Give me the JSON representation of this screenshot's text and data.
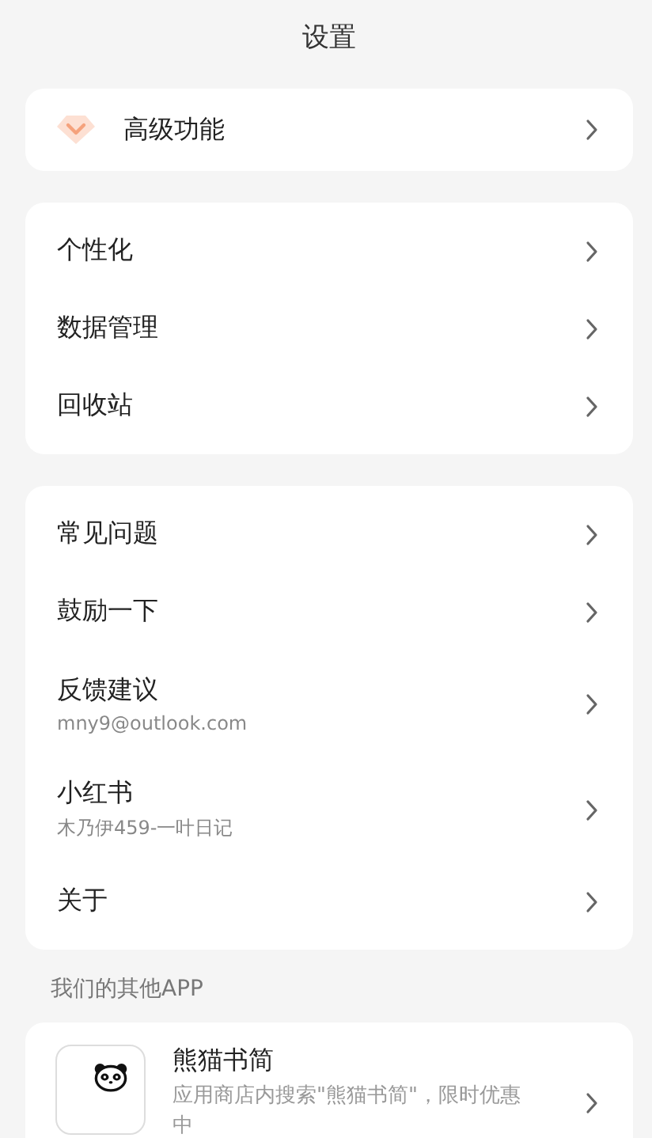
{
  "title": "设置",
  "groups": [
    {
      "items": [
        {
          "kind": "premium",
          "label": "高级功能"
        }
      ]
    },
    {
      "items": [
        {
          "label": "个性化"
        },
        {
          "label": "数据管理"
        },
        {
          "label": "回收站"
        }
      ]
    },
    {
      "items": [
        {
          "label": "常见问题"
        },
        {
          "label": "鼓励一下"
        },
        {
          "label": "反馈建议",
          "subtitle": "mny9@outlook.com"
        },
        {
          "label": "小红书",
          "subtitle": "木乃伊459-一叶日记"
        },
        {
          "label": "关于"
        }
      ]
    }
  ],
  "other_apps": {
    "heading": "我们的其他APP",
    "apps": [
      {
        "name": "熊猫书简",
        "description": "应用商店内搜索\"熊猫书简\"，限时优惠中"
      }
    ]
  }
}
